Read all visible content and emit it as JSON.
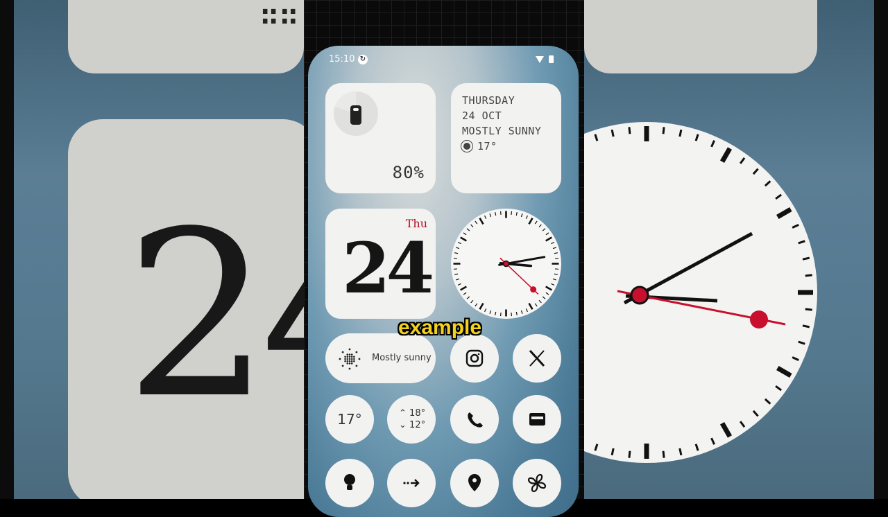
{
  "status_bar": {
    "time": "15:10",
    "sync_glyph": "↻"
  },
  "battery_widget": {
    "percent": "80%",
    "level": 0.8,
    "icon": "phone-icon"
  },
  "weather_widget": {
    "day": "THURSDAY",
    "date": "24 OCT",
    "condition": "MOSTLY SUNNY",
    "temperature": "17°",
    "icon": "sun-icon"
  },
  "date_widget": {
    "weekday": "Thu",
    "day": "24",
    "accent": "#b0102a"
  },
  "clock_widget": {
    "hour": 3,
    "minute": 10,
    "second": 17,
    "accent": "#c8102e"
  },
  "caption": "example",
  "weather_pill": {
    "label": "Mostly sunny",
    "icon": "sun-dots-icon"
  },
  "app_icons": [
    {
      "name": "instagram-icon",
      "glyph": "◎"
    },
    {
      "name": "x-icon",
      "glyph": "𝕏"
    },
    {
      "name": "phone-call-icon",
      "glyph": "✆"
    },
    {
      "name": "wallet-icon",
      "glyph": "▭"
    },
    {
      "name": "lightbulb-icon",
      "glyph": "●"
    },
    {
      "name": "arrow-icon",
      "glyph": "⇢"
    },
    {
      "name": "location-pin-icon",
      "glyph": "⬤"
    },
    {
      "name": "fan-icon",
      "glyph": "✢"
    }
  ],
  "temp_widget": {
    "current": "17°"
  },
  "hilo_widget": {
    "high": "18°",
    "low": "12°",
    "up_glyph": "⌃",
    "down_glyph": "⌄"
  },
  "background": {
    "date": "24",
    "dots": "∷∷"
  }
}
